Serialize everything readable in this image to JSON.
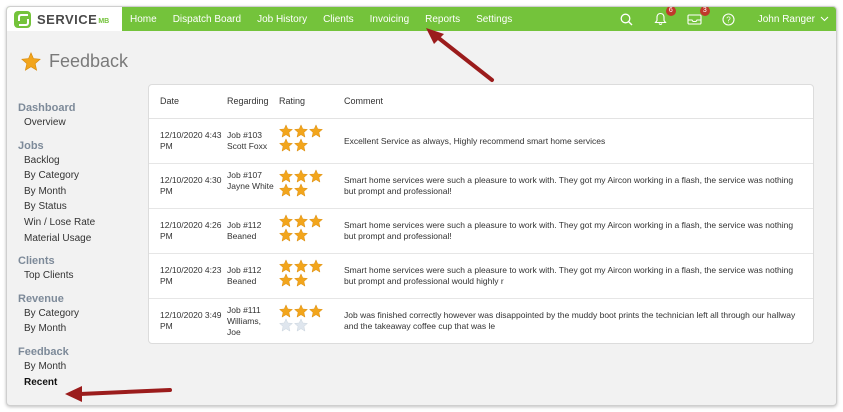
{
  "brand": {
    "name": "SERVICE",
    "suffix": "MB"
  },
  "nav": [
    "Home",
    "Dispatch Board",
    "Job History",
    "Clients",
    "Invoicing",
    "Reports",
    "Settings"
  ],
  "notifications": {
    "bell_count": "6",
    "mail_count": "3"
  },
  "user": {
    "name": "John Ranger"
  },
  "page": {
    "title": "Feedback"
  },
  "sidebar": [
    {
      "heading": "Dashboard",
      "items": [
        "Overview"
      ]
    },
    {
      "heading": "Jobs",
      "items": [
        "Backlog",
        "By Category",
        "By Month",
        "By Status",
        "Win / Lose Rate",
        "Material Usage"
      ]
    },
    {
      "heading": "Clients",
      "items": [
        "Top Clients"
      ]
    },
    {
      "heading": "Revenue",
      "items": [
        "By Category",
        "By Month"
      ]
    },
    {
      "heading": "Feedback",
      "items": [
        "By Month",
        "Recent"
      ]
    }
  ],
  "active_sidebar_item": "Recent",
  "table": {
    "columns": [
      "Date",
      "Regarding",
      "Rating",
      "Comment"
    ],
    "rows": [
      {
        "date": "12/10/2020 4:43 PM",
        "regarding": "Job #103 Scott Foxx",
        "rating": 5,
        "comment": "Excellent Service as always, Highly recommend smart home services"
      },
      {
        "date": "12/10/2020 4:30 PM",
        "regarding": "Job #107 Jayne White",
        "rating": 5,
        "comment": "Smart home services were such a pleasure to work with. They got my Aircon working in a flash, the service was nothing but prompt and professional!"
      },
      {
        "date": "12/10/2020 4:26 PM",
        "regarding": "Job #112 Beaned",
        "rating": 5,
        "comment": "Smart home services were such a pleasure to work with. They got my Aircon working in a flash, the service was nothing but prompt and professional!"
      },
      {
        "date": "12/10/2020 4:23 PM",
        "regarding": "Job #112 Beaned",
        "rating": 5,
        "comment": "Smart home services were such a pleasure to work with. They got my Aircon working in a flash, the service was nothing but prompt and professional would highly r"
      },
      {
        "date": "12/10/2020 3:49 PM",
        "regarding": "Job #111 Williams, Joe",
        "rating": 3,
        "comment": "Job was finished correctly however was disappointed by the muddy boot prints the technician left all through our hallway and the takeaway coffee cup that was le"
      }
    ]
  },
  "colors": {
    "brand_green": "#74c33b",
    "star_gold": "#f2a51c",
    "star_empty": "#dfe6ee",
    "arrow": "#9b1c1c"
  }
}
